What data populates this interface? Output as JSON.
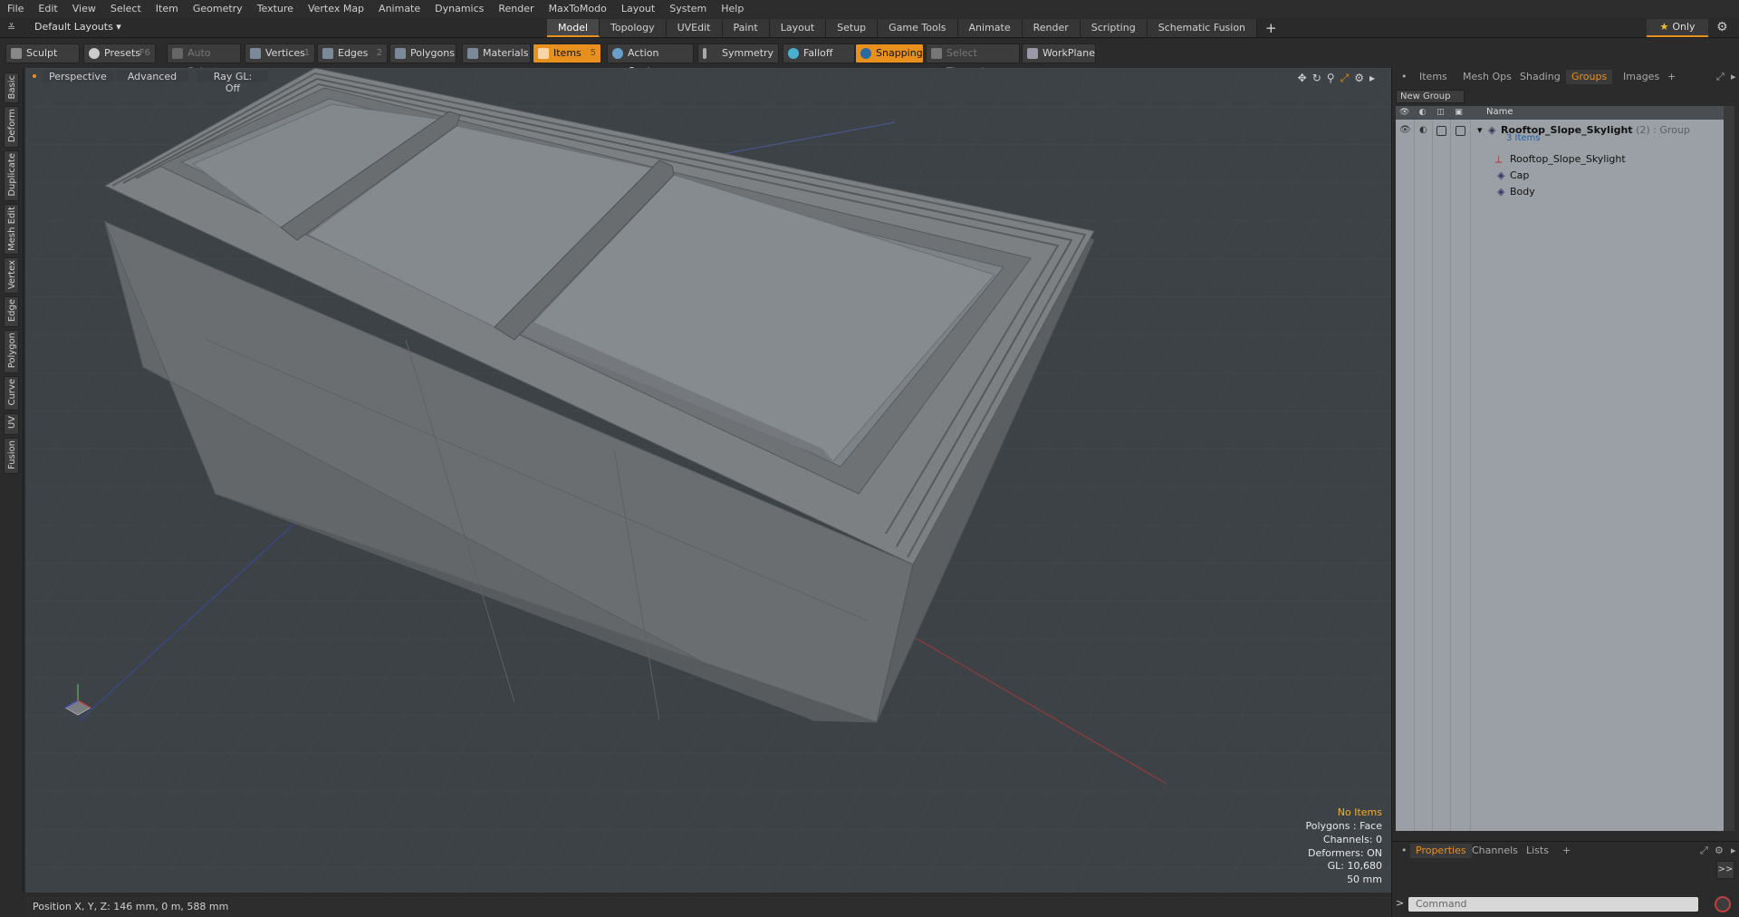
{
  "menu": [
    "File",
    "Edit",
    "View",
    "Select",
    "Item",
    "Geometry",
    "Texture",
    "Vertex Map",
    "Animate",
    "Dynamics",
    "Render",
    "MaxToModo",
    "Layout",
    "System",
    "Help"
  ],
  "layout": {
    "select_label": "Default Layouts ▾",
    "tabs": [
      "Model",
      "Topology",
      "UVEdit",
      "Paint",
      "Layout",
      "Setup",
      "Game Tools",
      "Animate",
      "Render",
      "Scripting",
      "Schematic Fusion"
    ],
    "active_tab": "Model",
    "add_symbol": "+",
    "only_label": "Only"
  },
  "toolbar": {
    "sculpt": "Sculpt",
    "presets": "Presets",
    "presets_key": "F6",
    "auto_select": "Auto Select",
    "vertices": "Vertices",
    "vertices_key": "1",
    "edges": "Edges",
    "edges_key": "2",
    "polygons": "Polygons",
    "materials": "Materials",
    "items": "Items",
    "items_key": "5",
    "action_center": "Action Center",
    "symmetry": "Symmetry",
    "falloff": "Falloff",
    "snapping": "Snapping",
    "select_through": "Select Through",
    "workplane": "WorkPlane"
  },
  "left_tabs": [
    "Basic",
    "Deform",
    "Duplicate",
    "Mesh Edit",
    "Vertex",
    "Edge",
    "Polygon",
    "Curve",
    "UV",
    "Fusion"
  ],
  "viewport": {
    "view_mode": "Perspective",
    "shading": "Advanced",
    "raygl": "Ray GL: Off",
    "info": {
      "no_items": "No Items",
      "polygons": "Polygons : Face",
      "channels": "Channels: 0",
      "deformers": "Deformers: ON",
      "gl": "GL: 10,680",
      "scale": "50 mm"
    }
  },
  "status": {
    "position": "Position X, Y, Z:   146 mm, 0 m, 588 mm"
  },
  "right_panel": {
    "tabs": [
      "Items",
      "Mesh Ops",
      "Shading",
      "Groups",
      "Images",
      "+"
    ],
    "active_tab": "Groups",
    "new_group": "New Group",
    "column_name": "Name",
    "group": {
      "name": "Rooftop_Slope_Skylight",
      "count_meta": "(2) : Group",
      "items_count": "3 Items",
      "children": [
        "Rooftop_Slope_Skylight",
        "Cap",
        "Body"
      ]
    },
    "bottom_tabs": [
      "Properties",
      "Channels",
      "Lists",
      "+"
    ],
    "bottom_active": "Properties",
    "expand": ">>",
    "command_placeholder": "Command"
  },
  "colors": {
    "accent": "#e8901e",
    "viewport_bg": "#3d4247",
    "mesh": "#6b6f72"
  }
}
